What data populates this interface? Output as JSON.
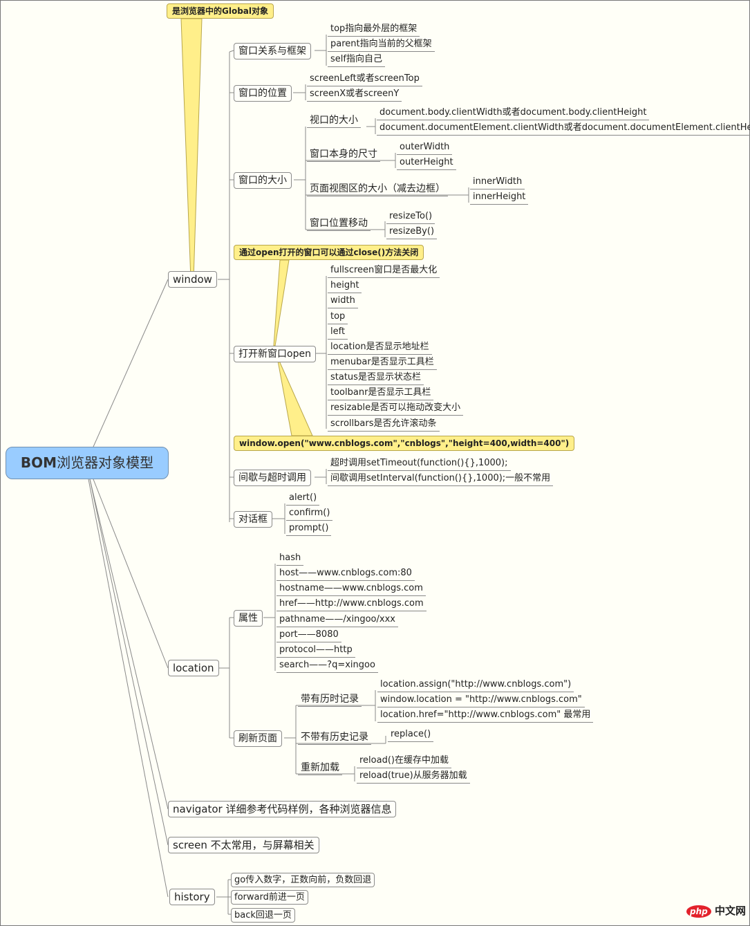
{
  "root": {
    "label_latin": "BOM",
    "label_cn": "浏览器对象模型",
    "color": "#99ccff"
  },
  "notes": {
    "global": "是浏览器中的Global对象",
    "close": "通过open打开的窗口可以通过close()方法关闭",
    "open_example": "window.open(\"www.cnblogs.com\",\"cnblogs\",\"height=400,width=400\")",
    "color": "#ffef8a"
  },
  "window": {
    "label": "window",
    "frames": {
      "label": "窗口关系与框架",
      "items": [
        "top指向最外层的框架",
        "parent指向当前的父框架",
        "self指向自己"
      ]
    },
    "position": {
      "label": "窗口的位置",
      "items": [
        "screenLeft或者screenTop",
        "screenX或者screenY"
      ]
    },
    "size": {
      "label": "窗口的大小",
      "viewport": {
        "label": "视口的大小",
        "items": [
          "document.body.clientWidth或者document.body.clientHeight",
          "document.documentElement.clientWidth或者document.documentElement.clientHeight"
        ]
      },
      "outer": {
        "label": "窗口本身的尺寸",
        "items": [
          "outerWidth",
          "outerHeight"
        ]
      },
      "inner": {
        "label": "页面视图区的大小（减去边框）",
        "items": [
          "innerWidth",
          "innerHeight"
        ]
      },
      "move": {
        "label": "窗口位置移动",
        "items": [
          "resizeTo()",
          "resizeBy()"
        ]
      }
    },
    "open": {
      "label": "打开新窗口open",
      "items": [
        "fullscreen窗口是否最大化",
        "height",
        "width",
        "top",
        "left",
        "location是否显示地址栏",
        "menubar是否显示工具栏",
        "status是否显示状态栏",
        "toolbanr是否显示工具栏",
        "resizable是否可以拖动改变大小",
        "scrollbars是否允许滚动条"
      ]
    },
    "timers": {
      "label": "间歇与超时调用",
      "items": [
        "超时调用setTimeout(function(){},1000);",
        "间歇调用setInterval(function(){},1000);一般不常用"
      ]
    },
    "dialogs": {
      "label": "对话框",
      "items": [
        "alert()",
        "confirm()",
        "prompt()"
      ]
    }
  },
  "location": {
    "label": "location",
    "props": {
      "label": "属性",
      "items": [
        "hash",
        "host——www.cnblogs.com:80",
        "hostname——www.cnblogs.com",
        "href——http://www.cnblogs.com",
        "pathname——/xingoo/xxx",
        "port——8080",
        "protocol——http",
        "search——?q=xingoo"
      ]
    },
    "refresh": {
      "label": "刷新页面",
      "with_history": {
        "label": "带有历时记录",
        "items": [
          "location.assign(\"http://www.cnblogs.com\")",
          "window.location = \"http://www.cnblogs.com\"",
          "location.href=\"http://www.cnblogs.com\"  最常用"
        ]
      },
      "no_history": {
        "label": "不带有历史记录",
        "items": [
          "replace()"
        ]
      },
      "reload": {
        "label": "重新加载",
        "items": [
          "reload()在缓存中加载",
          "reload(true)从服务器加载"
        ]
      }
    }
  },
  "navigator": {
    "label": "navigator 详细参考代码样例，各种浏览器信息"
  },
  "screen": {
    "label": "screen 不太常用，与屏幕相关"
  },
  "history": {
    "label": "history",
    "items": [
      "go传入数字，正数向前，负数回退",
      "forward前进一页",
      "back回退一页"
    ]
  },
  "watermark": {
    "logo": "php",
    "text": "中文网"
  }
}
